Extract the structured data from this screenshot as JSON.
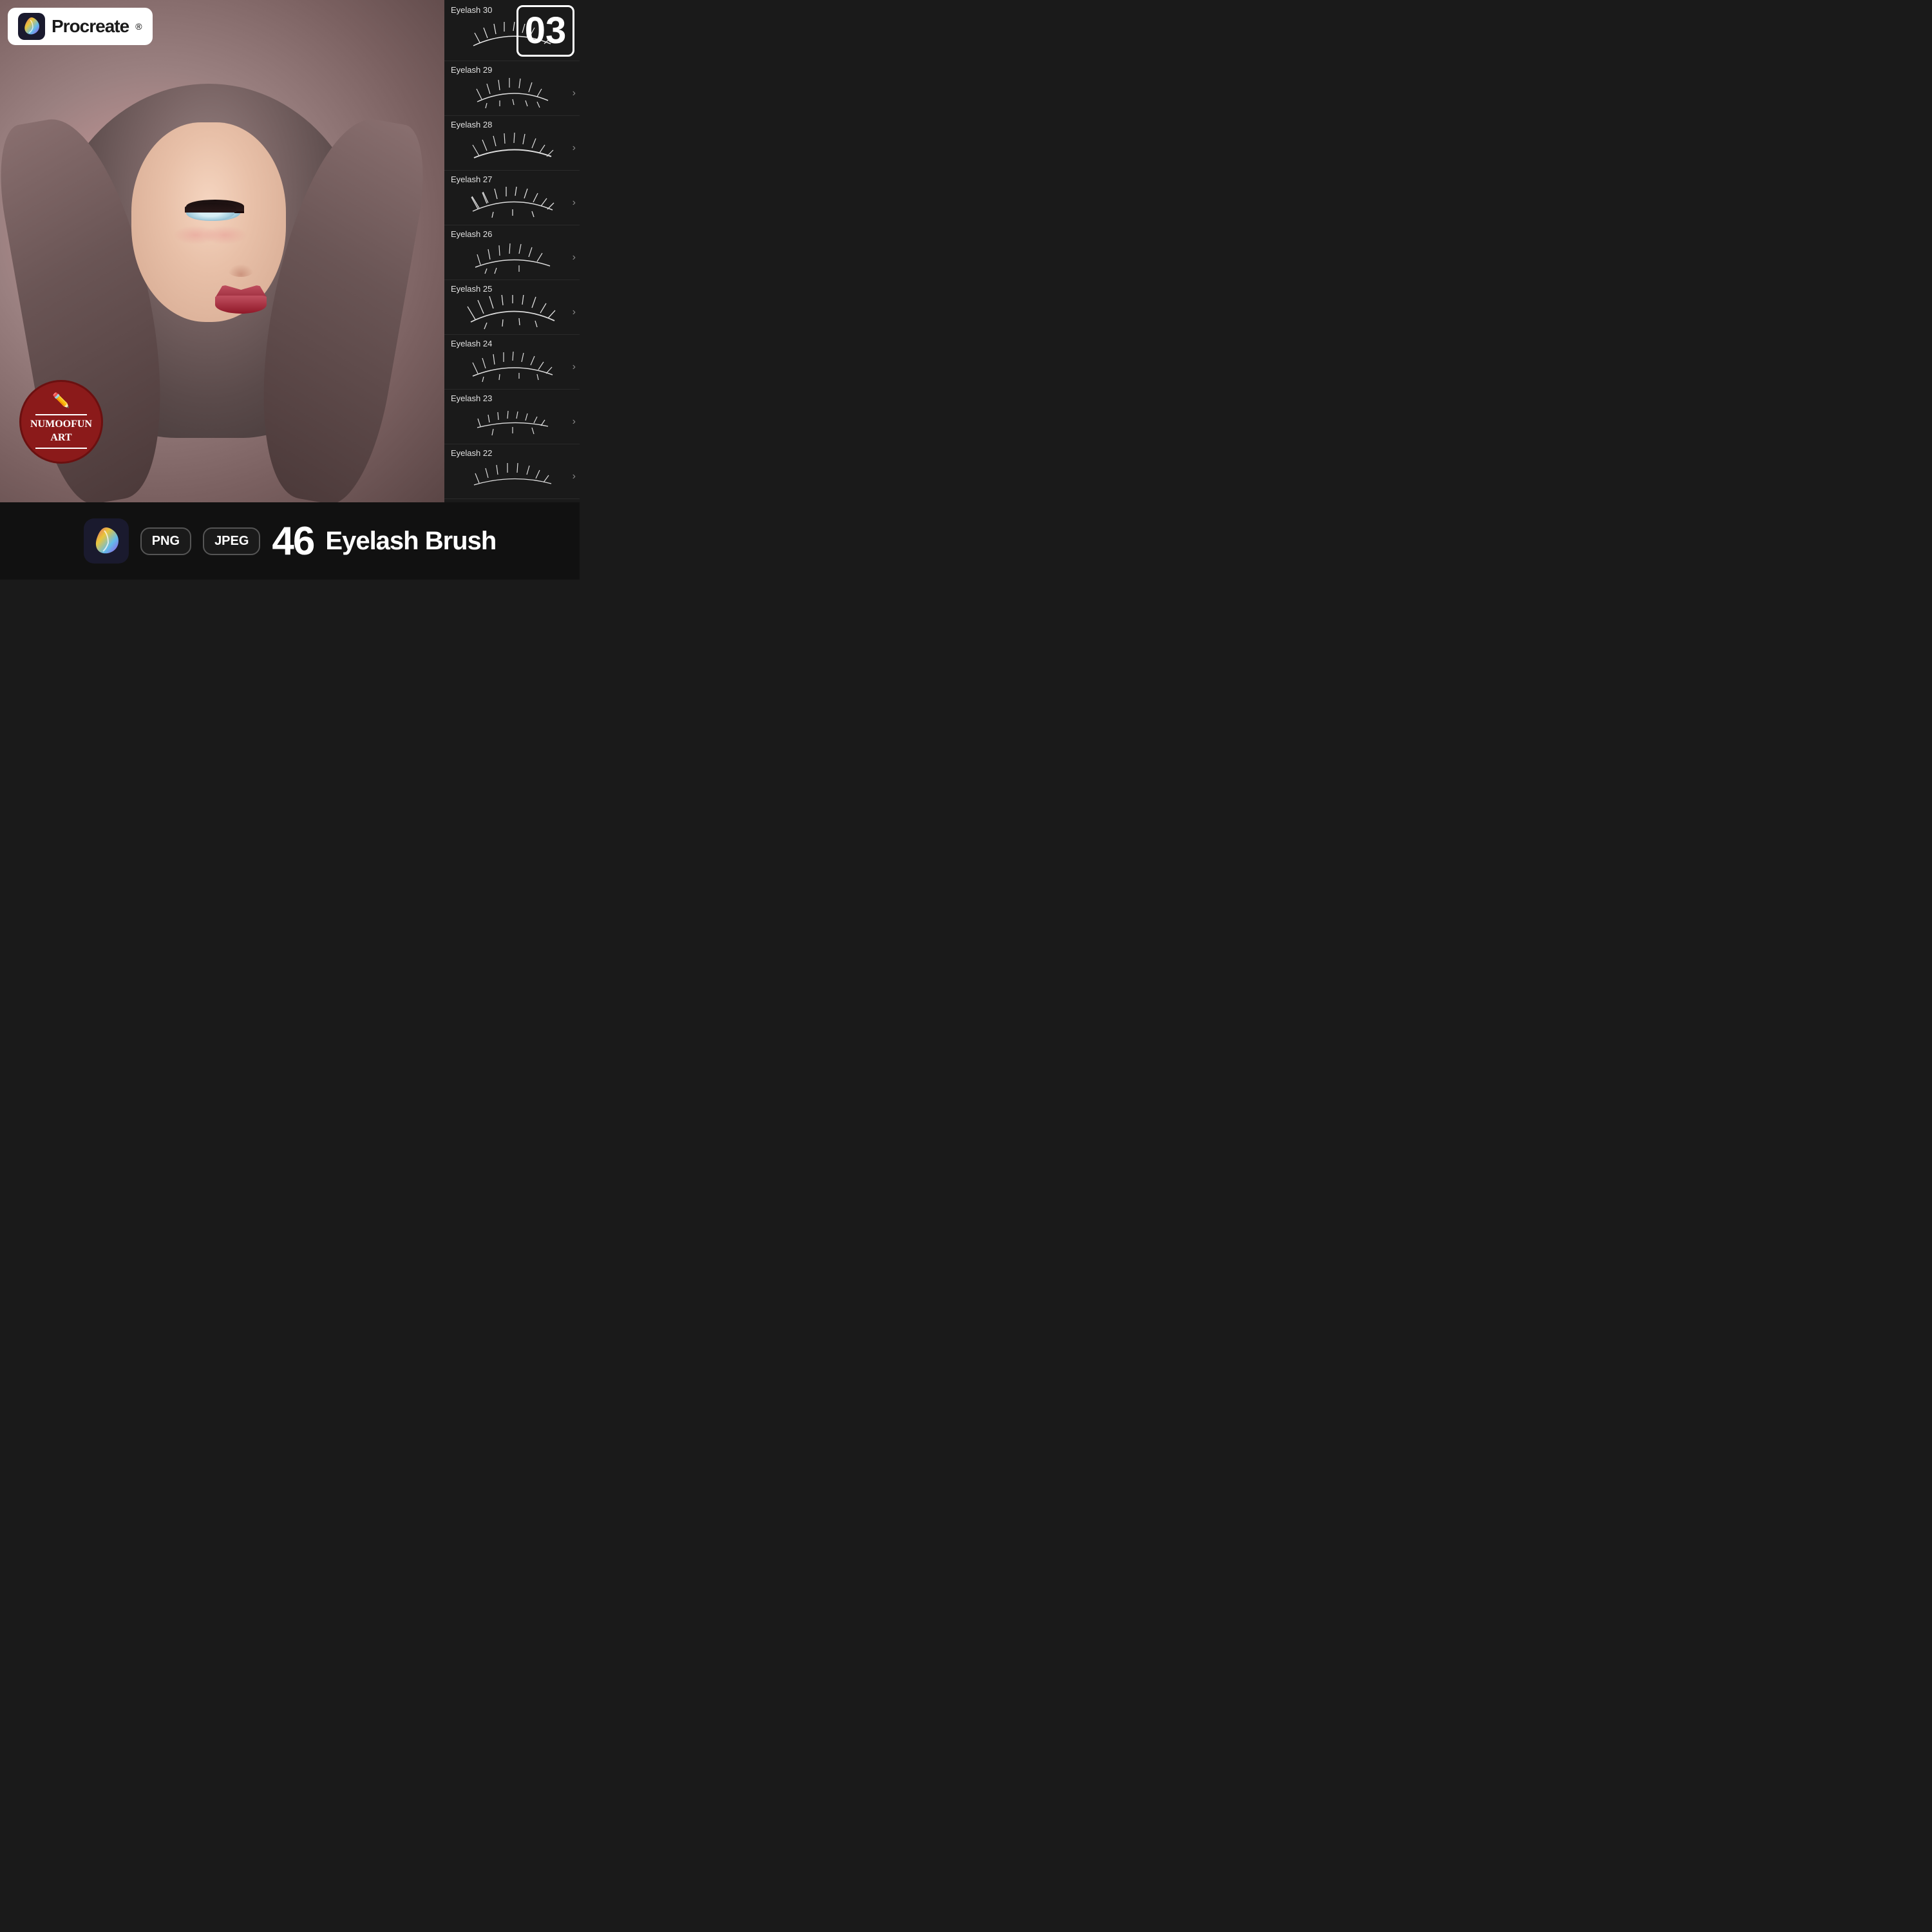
{
  "app": {
    "title": "Procreate",
    "logo_text": "Procreate",
    "registered_symbol": "®"
  },
  "badge_number": "03",
  "watermark": {
    "name": "NuMooFun Art",
    "line1": "NuMooFun",
    "line2": "Art"
  },
  "brush_panel": {
    "items": [
      {
        "id": "eyelash30",
        "label": "Eyelash 30",
        "index": 0
      },
      {
        "id": "eyelash29",
        "label": "Eyelash 29",
        "index": 1
      },
      {
        "id": "eyelash28",
        "label": "Eyelash 28",
        "index": 2
      },
      {
        "id": "eyelash27",
        "label": "Eyelash 27",
        "index": 3
      },
      {
        "id": "eyelash26",
        "label": "Eyelash 26",
        "index": 4
      },
      {
        "id": "eyelash25",
        "label": "Eyelash 25",
        "index": 5
      },
      {
        "id": "eyelash24",
        "label": "Eyelash 24",
        "index": 6
      },
      {
        "id": "eyelash23",
        "label": "Eyelash 23",
        "index": 7
      },
      {
        "id": "eyelash22",
        "label": "Eyelash 22",
        "index": 8
      }
    ]
  },
  "bottom_bar": {
    "formats": [
      "PNG",
      "JPEG"
    ],
    "count": "46",
    "product_name": "Eyelash Brush"
  }
}
